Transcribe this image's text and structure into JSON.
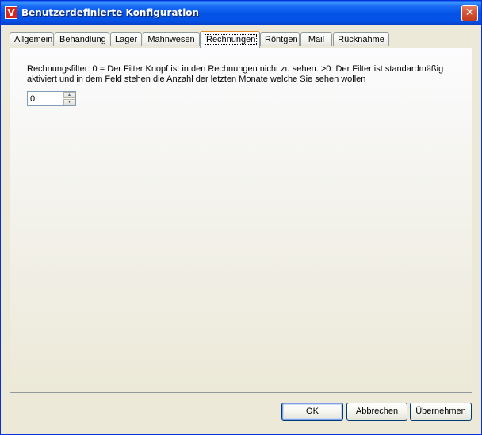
{
  "window": {
    "title": "Benutzerdefinierte Konfiguration",
    "app_icon_letter": "V",
    "close_glyph": "✕"
  },
  "tabs": [
    {
      "label": "Allgemein",
      "active": false
    },
    {
      "label": "Behandlung",
      "active": false
    },
    {
      "label": "Lager",
      "active": false
    },
    {
      "label": "Mahnwesen",
      "active": false
    },
    {
      "label": "Rechnungen",
      "active": true
    },
    {
      "label": "Röntgen",
      "active": false
    },
    {
      "label": "Mail",
      "active": false
    },
    {
      "label": "Rücknahme",
      "active": false
    }
  ],
  "panel": {
    "description": "Rechnungsfilter: 0 = Der Filter Knopf ist in den Rechnungen nicht zu sehen. >0: Der Filter ist standardmäßig aktiviert und in dem Feld stehen die Anzahl der letzten Monate welche Sie sehen wollen",
    "filter_value": "0"
  },
  "buttons": {
    "ok": "OK",
    "cancel": "Abbrechen",
    "apply": "Übernehmen"
  },
  "colors": {
    "titlebar": "#0453e6",
    "active_tab_accent": "#e68b2c",
    "face": "#ece9d8"
  }
}
